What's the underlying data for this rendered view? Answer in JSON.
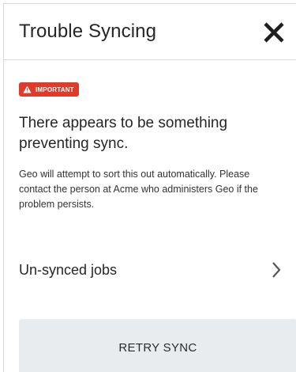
{
  "dialog": {
    "title": "Trouble Syncing",
    "close_icon": "close-icon"
  },
  "badge": {
    "label": "IMPORTANT",
    "icon": "warning-triangle-icon",
    "color": "#e03b2a"
  },
  "message": {
    "headline": "There appears to be something preventing sync.",
    "body": "Geo will attempt to sort this out automatically. Please contact the person at Acme who administers Geo if the problem persists."
  },
  "unsynced": {
    "label": "Un-synced jobs",
    "icon": "chevron-right-icon"
  },
  "actions": {
    "retry_label": "RETRY SYNC"
  }
}
